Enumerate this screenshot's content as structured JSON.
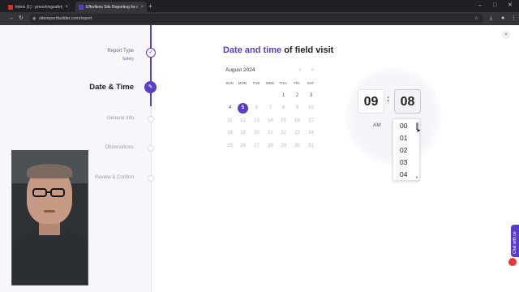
{
  "browser": {
    "tabs": [
      {
        "label": "Inbox (1) - prooshingsafety@g",
        "favicon_color": "#d93025",
        "active": false
      },
      {
        "label": "Effortless Site Reporting for co",
        "favicon_color": "#5b3cc4",
        "active": true
      }
    ],
    "new_tab_icon": "+",
    "url": "sitereportbuilder.com/report"
  },
  "sidebar": {
    "steps": [
      {
        "title": "Report Type",
        "subtitle": "Safety",
        "state": "done"
      },
      {
        "title": "Date & Time",
        "subtitle": "",
        "state": "current"
      },
      {
        "title": "General Info",
        "subtitle": "",
        "state": "pending"
      },
      {
        "title": "Observations",
        "subtitle": "",
        "state": "pending"
      },
      {
        "title": "Review & Confirm",
        "subtitle": "",
        "state": "pending"
      }
    ]
  },
  "main": {
    "heading_accent": "Date and time",
    "heading_rest": " of field visit",
    "close_icon": "×"
  },
  "calendar": {
    "month_label": "August 2024",
    "prev_icon": "‹",
    "next_icon": "›",
    "weekdays": [
      "SUN",
      "MON",
      "TUE",
      "WED",
      "THU",
      "FRI",
      "SAT"
    ],
    "weeks": [
      [
        "",
        "",
        "",
        "",
        "1",
        "2",
        "3"
      ],
      [
        "4",
        "5",
        "6",
        "7",
        "8",
        "9",
        "10"
      ],
      [
        "11",
        "12",
        "13",
        "14",
        "15",
        "16",
        "17"
      ],
      [
        "18",
        "19",
        "20",
        "21",
        "22",
        "23",
        "24"
      ],
      [
        "25",
        "26",
        "27",
        "28",
        "29",
        "30",
        "31"
      ]
    ],
    "selected": "5",
    "available": [
      "1",
      "2",
      "3",
      "4",
      "5"
    ]
  },
  "time": {
    "hour": "09",
    "separator": ":",
    "minute": "08",
    "period": "AM",
    "minute_options": [
      "00",
      "01",
      "02",
      "03",
      "04"
    ]
  },
  "widgets": {
    "chat_label": "Chat with us"
  },
  "colors": {
    "accent": "#5b3cc4",
    "pending": "#d9d9e3"
  }
}
